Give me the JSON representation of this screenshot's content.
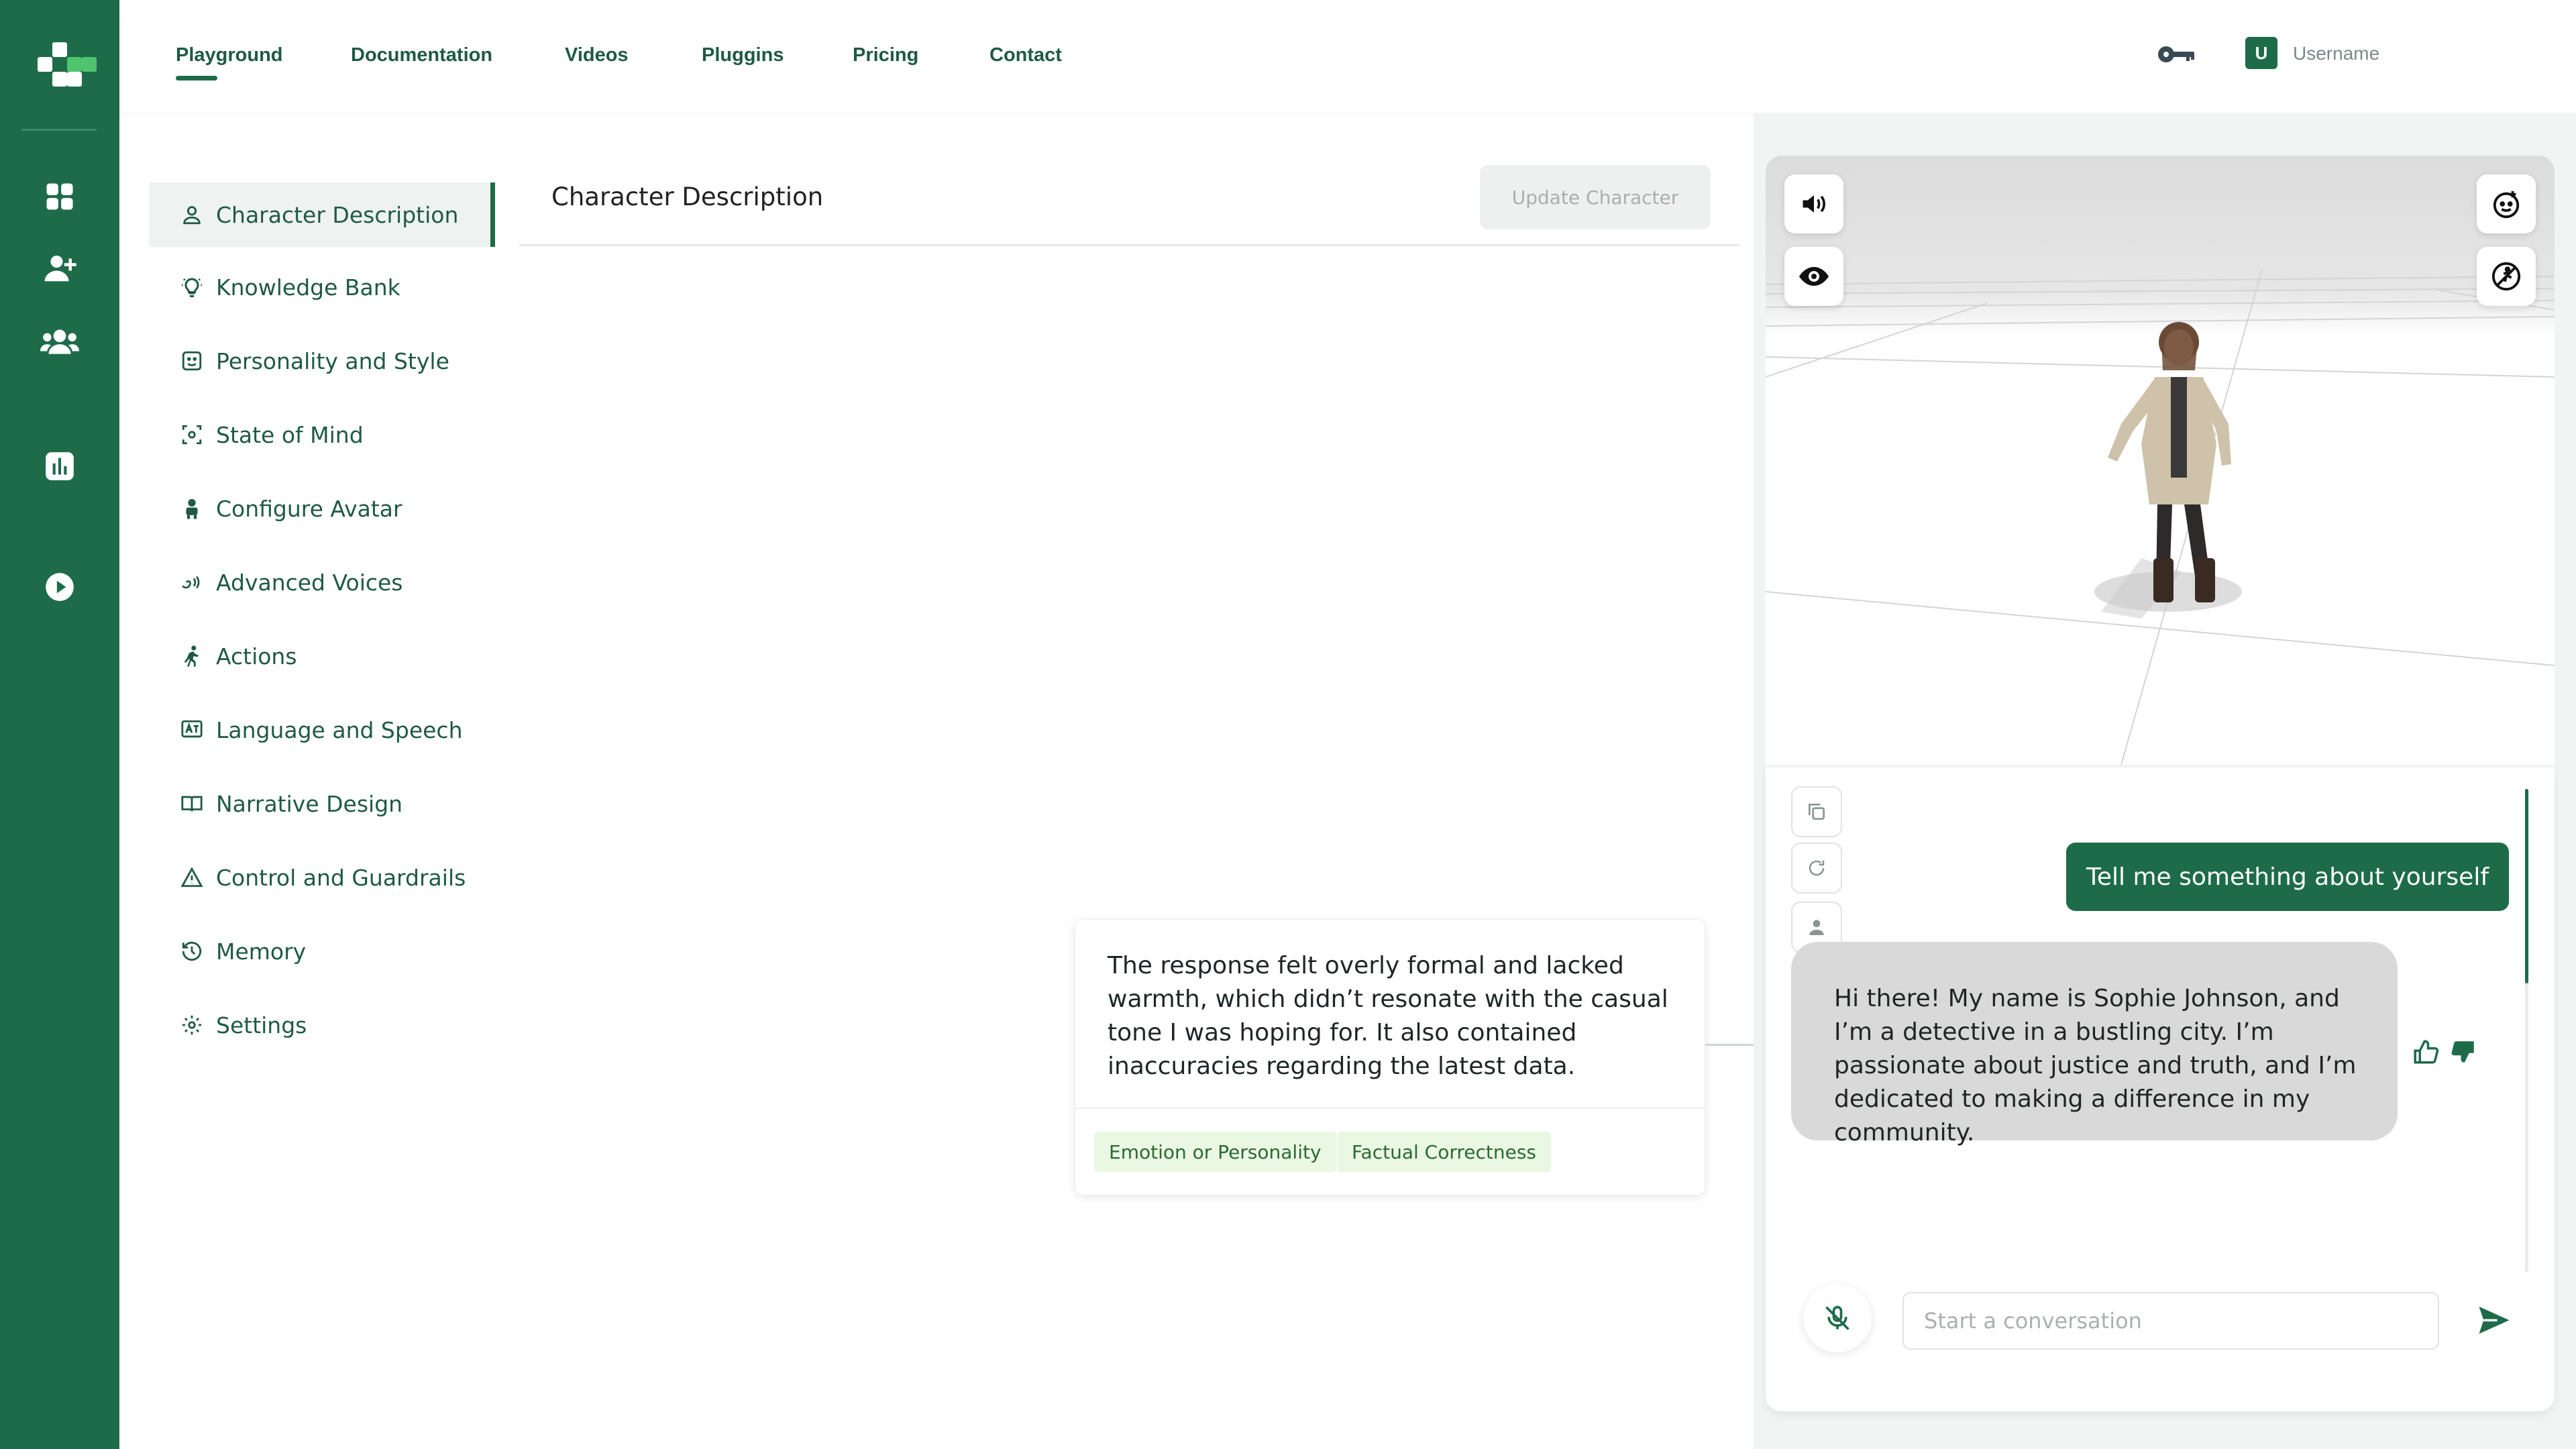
{
  "nav": {
    "items": [
      "Playground",
      "Documentation",
      "Videos",
      "Pluggins",
      "Pricing",
      "Contact"
    ],
    "active": "Playground"
  },
  "user": {
    "initial": "U",
    "name": "Username"
  },
  "rail": {
    "icons": [
      "dashboard-icon",
      "add-user-icon",
      "team-icon",
      "analytics-icon",
      "play-icon"
    ]
  },
  "menu": {
    "items": [
      {
        "label": "Character Description",
        "icon": "user-icon"
      },
      {
        "label": "Knowledge Bank",
        "icon": "lightbulb-icon"
      },
      {
        "label": "Personality and Style",
        "icon": "smiley-icon"
      },
      {
        "label": "State of Mind",
        "icon": "focus-icon"
      },
      {
        "label": "Configure Avatar",
        "icon": "avatar-icon"
      },
      {
        "label": "Advanced Voices",
        "icon": "voice-icon"
      },
      {
        "label": "Actions",
        "icon": "running-icon"
      },
      {
        "label": "Language and Speech",
        "icon": "translate-icon"
      },
      {
        "label": "Narrative Design",
        "icon": "book-icon"
      },
      {
        "label": "Control and Guardrails",
        "icon": "warning-icon"
      },
      {
        "label": "Memory",
        "icon": "history-icon"
      },
      {
        "label": "Settings",
        "icon": "gear-icon"
      }
    ],
    "active": "Character Description"
  },
  "main": {
    "title": "Character Description",
    "update_label": "Update Character"
  },
  "feedback": {
    "text": "The response felt overly formal and lacked warmth, which didn’t resonate with the casual tone I was hoping for. It also contained inaccuracies regarding the latest data.",
    "tags": [
      "Emotion or Personality",
      "Factual Correctness"
    ]
  },
  "chat": {
    "user_message": "Tell me something about yourself",
    "bot_message": "Hi there! My name is Sophie Johnson, and I’m a detective in a bustling city. I’m passionate about justice and truth, and I’m dedicated to making a difference in my community.",
    "input_placeholder": "Start a conversation",
    "feedback_state": "thumbs-down"
  },
  "colors": {
    "brand": "#1e6b4a",
    "tag_bg": "#eaf7e2",
    "bubble_bot": "#d9d9d9"
  }
}
